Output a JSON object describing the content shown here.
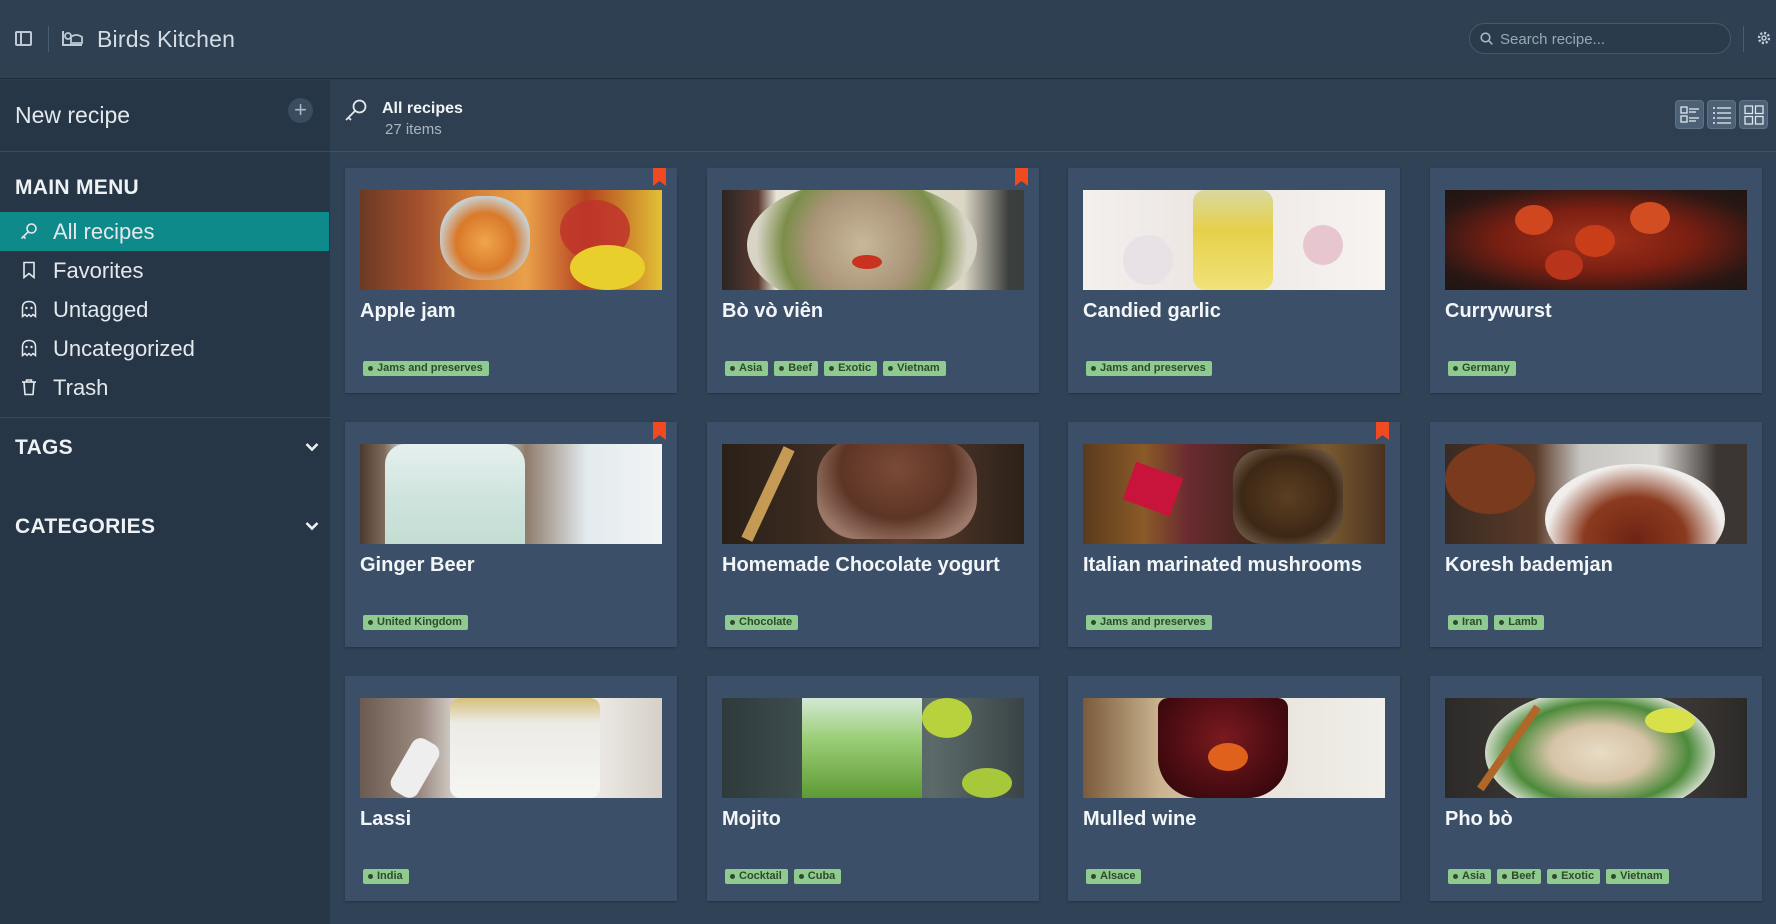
{
  "app": {
    "title": "Birds Kitchen"
  },
  "search": {
    "placeholder": "Search recipe..."
  },
  "sidebar": {
    "new_recipe_label": "New recipe",
    "main_menu_title": "MAIN MENU",
    "items": [
      {
        "label": "All recipes",
        "icon": "key-icon",
        "active": true
      },
      {
        "label": "Favorites",
        "icon": "bookmark-icon",
        "active": false
      },
      {
        "label": "Untagged",
        "icon": "ghost-icon",
        "active": false
      },
      {
        "label": "Uncategorized",
        "icon": "ghost-icon",
        "active": false
      },
      {
        "label": "Trash",
        "icon": "trash-icon",
        "active": false
      }
    ],
    "tags_title": "TAGS",
    "categories_title": "CATEGORIES"
  },
  "main": {
    "title": "All recipes",
    "count": "27 items"
  },
  "colors": {
    "accent": "#0e8a8a",
    "bookmark": "#f04a22",
    "tag": "#8fca8f",
    "card": "#3b5068"
  },
  "recipes": [
    {
      "name": "Apple jam",
      "tags": [
        "Jams and preserves"
      ],
      "favorite": true
    },
    {
      "name": "Bò vò viên",
      "tags": [
        "Asia",
        "Beef",
        "Exotic",
        "Vietnam"
      ],
      "favorite": true
    },
    {
      "name": "Candied garlic",
      "tags": [
        "Jams and preserves"
      ],
      "favorite": false
    },
    {
      "name": "Currywurst",
      "tags": [
        "Germany"
      ],
      "favorite": false
    },
    {
      "name": "Ginger Beer",
      "tags": [
        "United Kingdom"
      ],
      "favorite": true
    },
    {
      "name": "Homemade Chocolate yogurt",
      "tags": [
        "Chocolate"
      ],
      "favorite": false
    },
    {
      "name": "Italian marinated mushrooms",
      "tags": [
        "Jams and preserves"
      ],
      "favorite": true
    },
    {
      "name": "Koresh bademjan",
      "tags": [
        "Iran",
        "Lamb"
      ],
      "favorite": false
    },
    {
      "name": "Lassi",
      "tags": [
        "India"
      ],
      "favorite": false
    },
    {
      "name": "Mojito",
      "tags": [
        "Cocktail",
        "Cuba"
      ],
      "favorite": false
    },
    {
      "name": "Mulled wine",
      "tags": [
        "Alsace"
      ],
      "favorite": false
    },
    {
      "name": "Pho bò",
      "tags": [
        "Asia",
        "Beef",
        "Exotic",
        "Vietnam"
      ],
      "favorite": false
    }
  ]
}
